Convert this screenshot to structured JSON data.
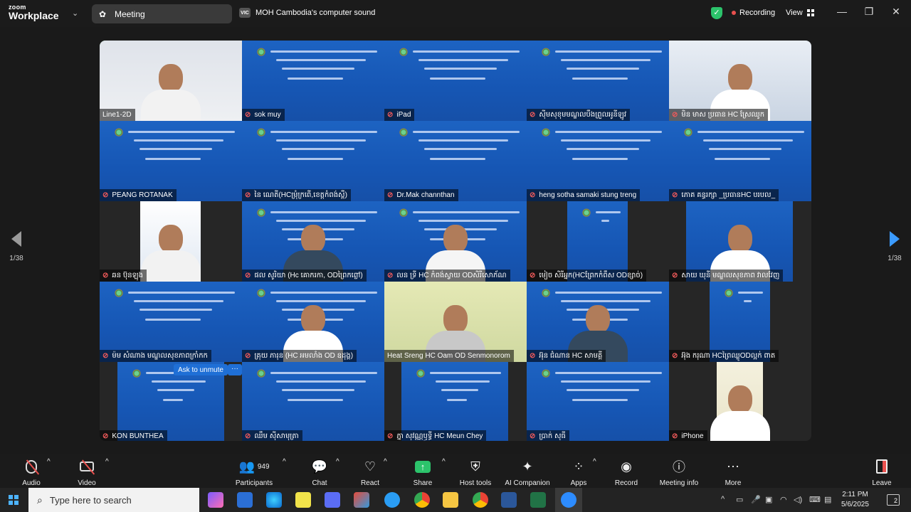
{
  "app": {
    "logo_top": "zoom",
    "logo_bottom": "Workplace"
  },
  "tabs": {
    "meeting": "Meeting",
    "share_badge": "VIC",
    "share_title": "MOH Cambodia's computer sound"
  },
  "status": {
    "recording": "Recording",
    "view": "View"
  },
  "navigation": {
    "page_left": "1/38",
    "page_right": "1/38"
  },
  "participants": [
    {
      "name": "Line1-2D",
      "kind": "video",
      "muted": false
    },
    {
      "name": "sok muy",
      "kind": "slide",
      "muted": true
    },
    {
      "name": "iPad",
      "kind": "slide",
      "muted": true
    },
    {
      "name": "ស៊ីមសុខុមមណ្ឌលបឹងព្រួលអូនីឡូវ",
      "kind": "slide",
      "muted": true
    },
    {
      "name": "មិន មាស ប្រធាន HC ស្រែឈូក",
      "kind": "video",
      "muted": true
    },
    {
      "name": "PEANG ROTANAK",
      "kind": "slide",
      "muted": true
    },
    {
      "name": "នៃ ណេតី(HCម្រុំក្រពើ,ខេត្តកំពង់ស្ពឺ)",
      "kind": "slide",
      "muted": true
    },
    {
      "name": "Dr.Mak channthan",
      "kind": "slide",
      "muted": true
    },
    {
      "name": "heng sotha samaki stung treng",
      "kind": "slide",
      "muted": true
    },
    {
      "name": "ភោគ គន្ធរក្សា _ប្រធានHC បរបល_",
      "kind": "slide",
      "muted": true
    },
    {
      "name": "ឆន ប៊ុនឡុង",
      "kind": "video",
      "muted": true
    },
    {
      "name": "ផល សូរិយា (Hc គោករកា, ODព្រៃកព្លៅ)",
      "kind": "video",
      "muted": true
    },
    {
      "name": "លន ទ្រី HC កំពង់ស្វាយ ODសិរីសោភ័ណ",
      "kind": "video",
      "muted": true
    },
    {
      "name": "មៀច សិរីអ្នក(HCព្រែកកំពឹស ODខ្សាច់)",
      "kind": "slide",
      "muted": true
    },
    {
      "name": "សាយ ឃុនី មណ្ឌលសុខភាព វាលវែញ",
      "kind": "video",
      "muted": true
    },
    {
      "name": "ម៉ម សំណាង មណ្ឌលសុខភាពក្រាំកក",
      "kind": "slide",
      "muted": true
    },
    {
      "name": "គ្រុយ ភារុន (HC អមលាំង OD ឧដុង្គ)",
      "kind": "video",
      "muted": true
    },
    {
      "name": "Heat Sreng HC Oam OD Senmonorom",
      "kind": "video",
      "muted": false
    },
    {
      "name": "អ៊ុន ជំណាន HC សាមគ្គី",
      "kind": "video",
      "muted": true
    },
    {
      "name": "អ៊ុង ករុណា HCព្រៃឈ្លូODល្អក់ ពាត",
      "kind": "slide",
      "muted": true
    },
    {
      "name": "KON BUNTHEA",
      "kind": "slide",
      "muted": true
    },
    {
      "name": "ឈឹម ស៊ីសាមុត្រា",
      "kind": "slide",
      "muted": true
    },
    {
      "name": "ភ្នា សុវណ្ណឫទ្ធី HC Meun Chey",
      "kind": "slide",
      "muted": true
    },
    {
      "name": "ប្រាក់ សុធី",
      "kind": "slide",
      "muted": true
    },
    {
      "name": "iPhone",
      "kind": "video",
      "muted": true
    }
  ],
  "tile_actions": {
    "ask_unmute": "Ask to unmute",
    "more": "···"
  },
  "toolbar": {
    "audio": "Audio",
    "video": "Video",
    "participants": "Participants",
    "participants_count": "949",
    "chat": "Chat",
    "react": "React",
    "share": "Share",
    "host_tools": "Host tools",
    "ai_companion": "AI Companion",
    "apps": "Apps",
    "record": "Record",
    "meeting_info": "Meeting info",
    "more": "More",
    "leave": "Leave"
  },
  "taskbar": {
    "search_placeholder": "Type here to search",
    "time": "2:11 PM",
    "date": "5/6/2025",
    "notifications": "2"
  },
  "colors": {
    "slide_blue": "#1656b4",
    "active_speaker": "#4ad37a",
    "muted_red": "#f05a5a",
    "share_green": "#2cc36b",
    "accent_blue": "#1f6fd6"
  },
  "icons": [
    "paw-icon",
    "shield-check-icon",
    "grid-icon",
    "chevron-left-icon",
    "chevron-right-icon",
    "mic-off-icon",
    "video-off-icon",
    "people-icon",
    "chat-icon",
    "heart-icon",
    "share-arrow-icon",
    "shield-icon",
    "sparkle-icon",
    "apps-icon",
    "record-icon",
    "info-icon",
    "more-icon",
    "leave-icon"
  ]
}
